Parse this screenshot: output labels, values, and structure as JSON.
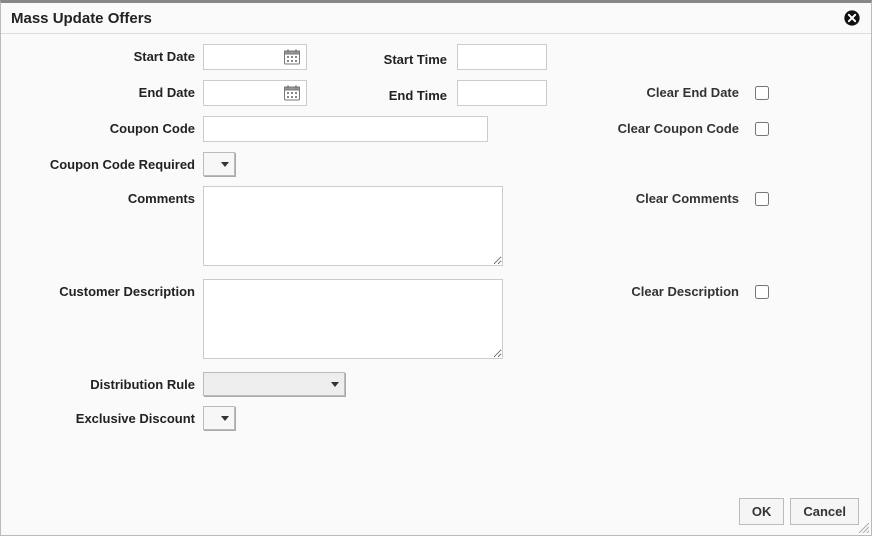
{
  "dialog": {
    "title": "Mass Update Offers"
  },
  "labels": {
    "startDate": "Start Date",
    "endDate": "End Date",
    "startTime": "Start Time",
    "endTime": "End Time",
    "couponCode": "Coupon Code",
    "couponCodeRequired": "Coupon Code Required",
    "comments": "Comments",
    "customerDescription": "Customer Description",
    "distributionRule": "Distribution Rule",
    "exclusiveDiscount": "Exclusive Discount",
    "clearEndDate": "Clear End Date",
    "clearCouponCode": "Clear Coupon Code",
    "clearComments": "Clear Comments",
    "clearDescription": "Clear Description"
  },
  "values": {
    "startDate": "",
    "endDate": "",
    "startTime": "",
    "endTime": "",
    "couponCode": "",
    "couponCodeRequired": "",
    "comments": "",
    "customerDescription": "",
    "distributionRule": "",
    "exclusiveDiscount": ""
  },
  "buttons": {
    "ok": "OK",
    "cancel": "Cancel"
  }
}
